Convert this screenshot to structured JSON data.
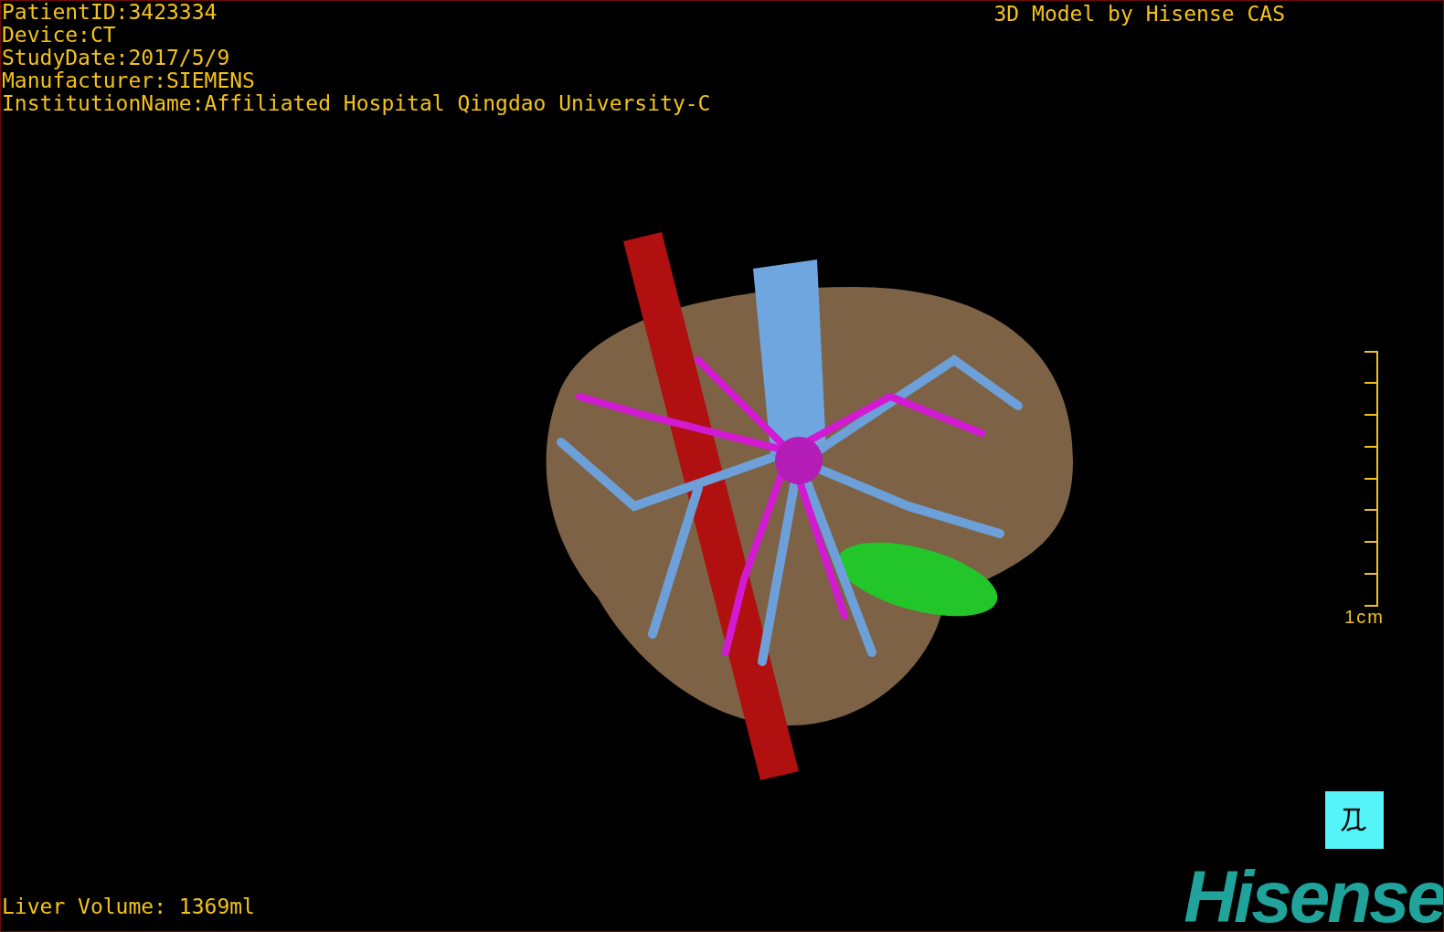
{
  "study_info": [
    "PatientID:3423334",
    "Device:CT",
    "StudyDate:2017/5/9",
    "Manufacturer:SIEMENS",
    "InstitutionName:Affiliated Hospital Qingdao University-C"
  ],
  "title": "3D Model by Hisense CAS",
  "scale_bar": {
    "label": "1cm"
  },
  "liver_volume": "Liver Volume: 1369ml",
  "logo": "Hisense"
}
